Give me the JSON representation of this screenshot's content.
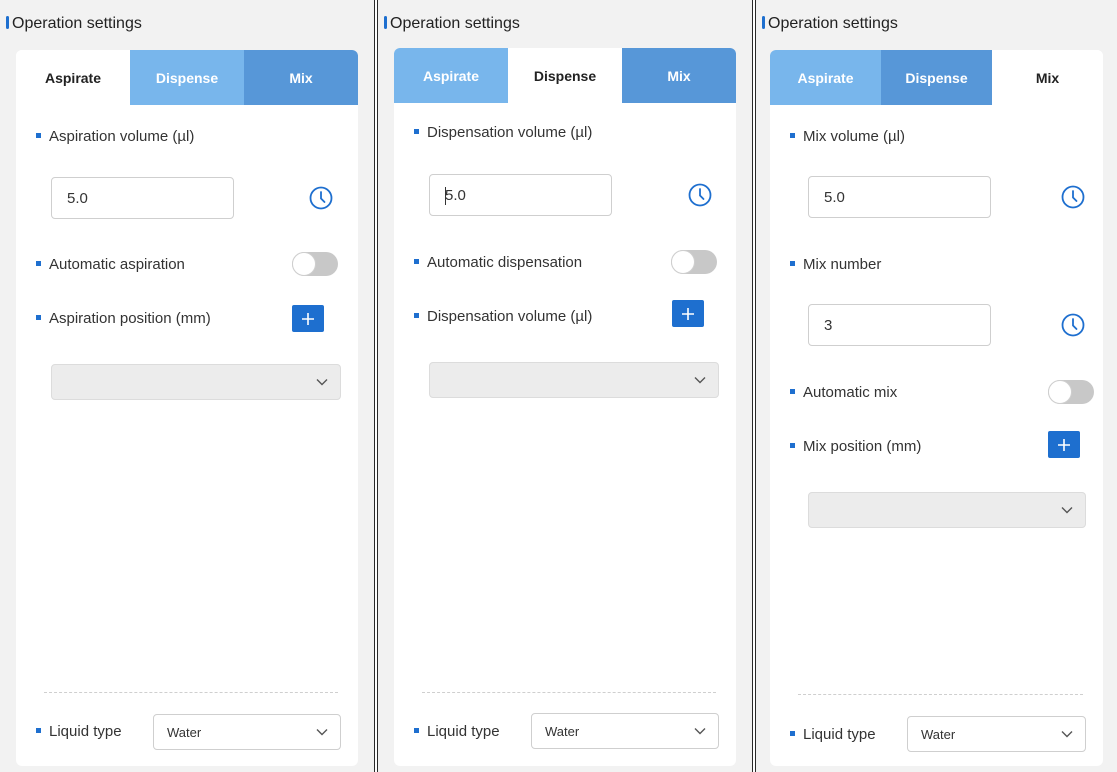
{
  "panels": [
    {
      "title": "Operation settings",
      "tabs": [
        "Aspirate",
        "Dispense",
        "Mix"
      ],
      "active_tab": "Aspirate",
      "volume_label": "Aspiration volume (µl)",
      "volume_value": "5.0",
      "auto_label": "Automatic aspiration",
      "position_label": "Aspiration position (mm)",
      "liquid_label": "Liquid type",
      "liquid_value": "Water"
    },
    {
      "title": "Operation settings",
      "tabs": [
        "Aspirate",
        "Dispense",
        "Mix"
      ],
      "active_tab": "Dispense",
      "volume_label": "Dispensation volume (µl)",
      "volume_value": "5.0",
      "auto_label": "Automatic dispensation",
      "position_label": "Dispensation volume (µl)",
      "liquid_label": "Liquid type",
      "liquid_value": "Water"
    },
    {
      "title": "Operation settings",
      "tabs": [
        "Aspirate",
        "Dispense",
        "Mix"
      ],
      "active_tab": "Mix",
      "volume_label": "Mix volume (µl)",
      "volume_value": "5.0",
      "number_label": "Mix number",
      "number_value": "3",
      "auto_label": "Automatic mix",
      "position_label": "Mix position (mm)",
      "liquid_label": "Liquid type",
      "liquid_value": "Water"
    }
  ],
  "colors": {
    "accent": "#1e6fcf",
    "tab_light": "#78b6ec",
    "tab_dark": "#5797d8",
    "toggle_off": "#c8c8c8"
  },
  "icons": {
    "clock": "clock-icon",
    "plus": "plus-icon",
    "dropdown": "chevron-down-icon"
  }
}
